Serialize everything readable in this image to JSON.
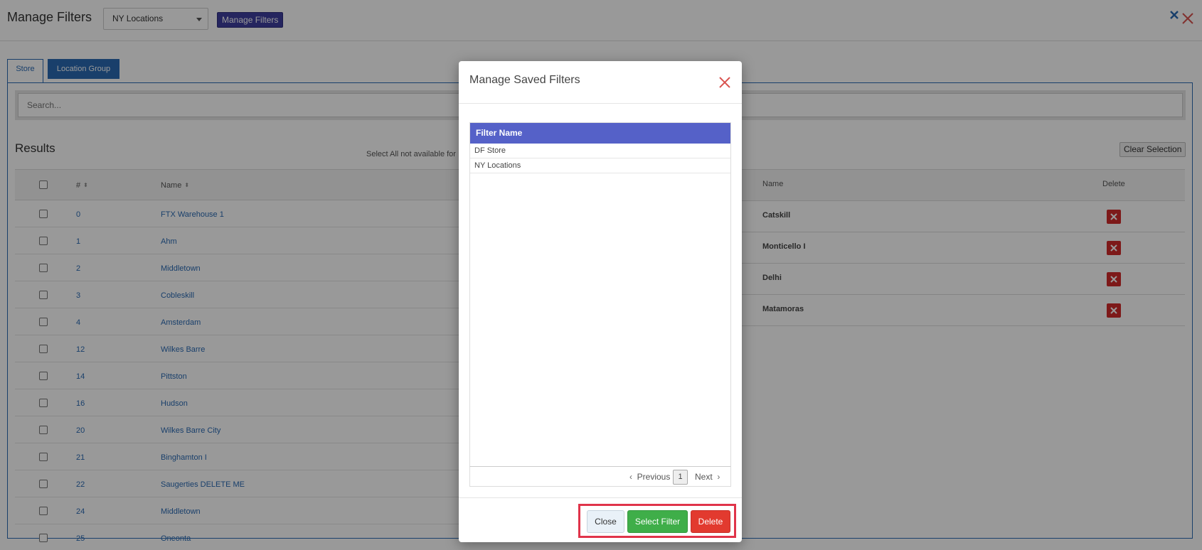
{
  "header": {
    "title": "Manage Filters",
    "filter_select_value": "NY Locations",
    "manage_button": "Manage Filters"
  },
  "tabs": [
    {
      "label": "Store",
      "active": true
    },
    {
      "label": "Location Group",
      "active": false
    }
  ],
  "search": {
    "placeholder": "Search..."
  },
  "results": {
    "title": "Results",
    "note": "Select All not available for",
    "clear_selection": "Clear Selection",
    "columns": {
      "num": "#",
      "name": "Name"
    },
    "rows": [
      {
        "num": "0",
        "name": "FTX Warehouse 1"
      },
      {
        "num": "1",
        "name": "Ahm"
      },
      {
        "num": "2",
        "name": "Middletown"
      },
      {
        "num": "3",
        "name": "Cobleskill"
      },
      {
        "num": "4",
        "name": "Amsterdam"
      },
      {
        "num": "12",
        "name": "Wilkes Barre"
      },
      {
        "num": "14",
        "name": "Pittston"
      },
      {
        "num": "16",
        "name": "Hudson"
      },
      {
        "num": "20",
        "name": "Wilkes Barre City"
      },
      {
        "num": "21",
        "name": "Binghamton I"
      },
      {
        "num": "22",
        "name": "Saugerties DELETE ME"
      },
      {
        "num": "24",
        "name": "Middletown"
      },
      {
        "num": "25",
        "name": "Oneonta"
      }
    ]
  },
  "selected": {
    "columns": {
      "name": "Name",
      "delete": "Delete"
    },
    "rows": [
      {
        "name": "Catskill"
      },
      {
        "name": "Monticello I"
      },
      {
        "name": "Delhi"
      },
      {
        "name": "Matamoras"
      }
    ]
  },
  "modal": {
    "title": "Manage Saved Filters",
    "column_header": "Filter Name",
    "rows": [
      {
        "name": "DF Store"
      },
      {
        "name": "NY Locations"
      }
    ],
    "pager": {
      "previous": "Previous",
      "page": "1",
      "next": "Next"
    },
    "buttons": {
      "close": "Close",
      "select": "Select Filter",
      "delete": "Delete"
    }
  },
  "colors": {
    "accent_blue": "#2a6ab3",
    "grid_header": "#5561c8",
    "select_green": "#3fae49",
    "delete_red": "#e23a2f",
    "highlight_red": "#e0344a"
  },
  "icons": [
    "close-icon",
    "caret-down-icon",
    "sort-icon",
    "chevron-left-icon",
    "chevron-right-icon",
    "delete-x-icon"
  ]
}
